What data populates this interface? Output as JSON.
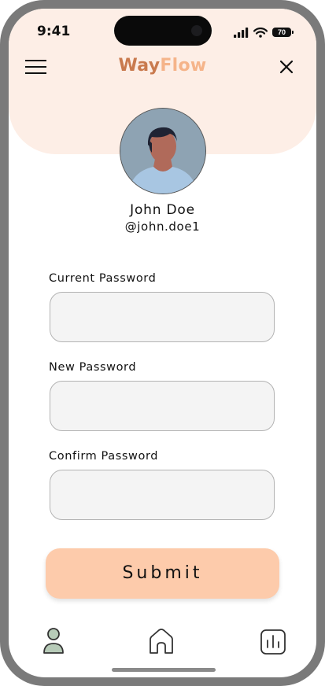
{
  "status_bar": {
    "time": "9:41",
    "battery_level": "70"
  },
  "header": {
    "brand_part1": "Way",
    "brand_part2": "Flow",
    "menu_icon": "hamburger-menu-icon",
    "close_icon": "close-icon"
  },
  "profile": {
    "name": "John Doe",
    "handle": "@john.doe1"
  },
  "form": {
    "current_password_label": "Current Password",
    "current_password_value": "",
    "new_password_label": "New Password",
    "new_password_value": "",
    "confirm_password_label": "Confirm Password",
    "confirm_password_value": "",
    "submit_label": "Submit"
  },
  "bottom_nav": {
    "items": [
      {
        "icon": "profile-icon",
        "active": true
      },
      {
        "icon": "home-icon",
        "active": false
      },
      {
        "icon": "stats-icon",
        "active": false
      }
    ]
  },
  "colors": {
    "header_bg": "#fdeee6",
    "brand_way": "#c97a4e",
    "brand_flow": "#f5b48a",
    "submit_bg": "#fdcbab",
    "input_bg": "#f4f4f4",
    "active_nav": "#b7cbb8"
  }
}
